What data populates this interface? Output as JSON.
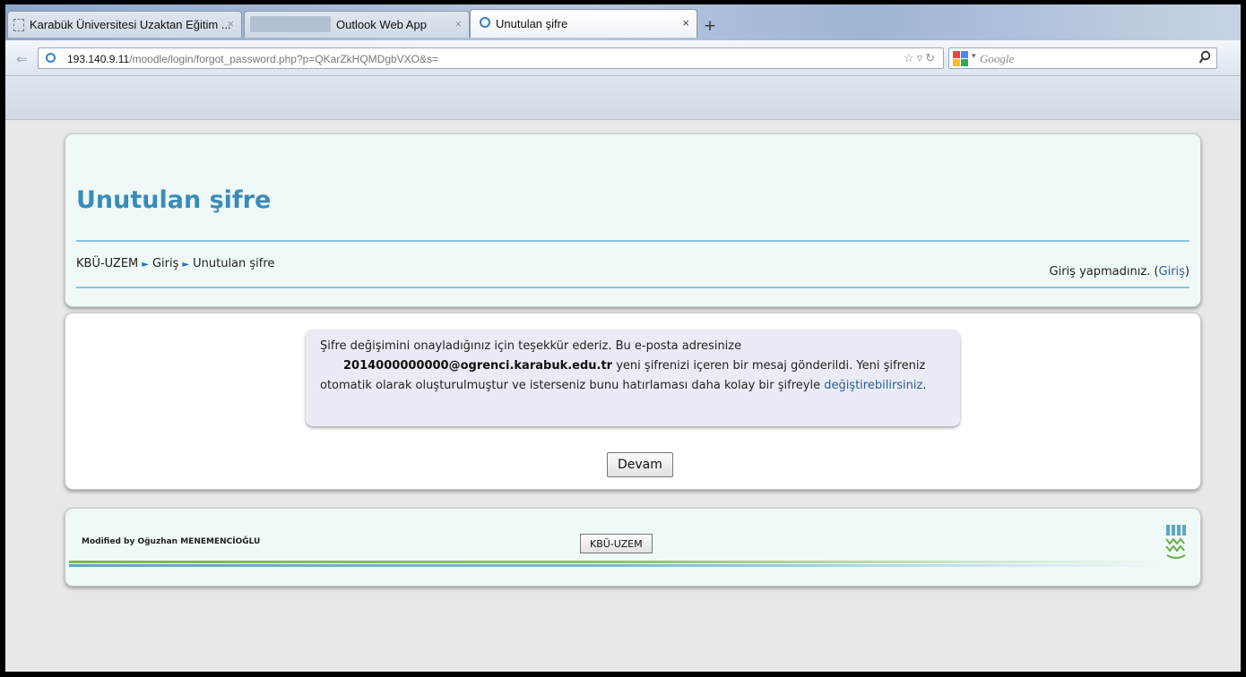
{
  "browser": {
    "tabs": [
      {
        "label": "Karabük Üniversitesi Uzaktan Eğitim ...",
        "close": "×"
      },
      {
        "label": "Outlook Web App",
        "close": "×"
      },
      {
        "label": "Unutulan şifre",
        "close": "×"
      }
    ],
    "new_tab_label": "+",
    "url_host": "193.140.9.11",
    "url_path": "/moodle/login/forgot_password.php?p=QKarZkHQMDgbVXO&s=",
    "search_placeholder": "Google",
    "icons": {
      "back": "back-arrow-icon",
      "site": "site-identity-icon",
      "bookmark": "star-icon",
      "reload": "reload-icon",
      "search_engine": "google-logo-icon",
      "search": "magnifier-icon"
    }
  },
  "header": {
    "title": "Unutulan şifre",
    "breadcrumb": [
      "KBÜ-UZEM",
      "Giriş",
      "Unutulan şifre"
    ],
    "breadcrumb_separator": "►",
    "login_status_prefix": "Giriş yapmadınız. (",
    "login_link": "Giriş",
    "login_status_suffix": ")"
  },
  "notice": {
    "line1": "Şifre değişimini onayladığınız için teşekkür ederiz. Bu e-posta adresinize",
    "email": "2014000000000@ogrenci.karabuk.edu.tr",
    "line2_rest": " yeni şifrenizi içeren bir mesaj gönderildi. Yeni şifreniz",
    "line3_prefix": "otomatik olarak oluşturulmuştur ve isterseniz bunu hatırlaması daha kolay bir şifreyle ",
    "line3_link": "değiştirebilirsiniz",
    "line3_suffix": "."
  },
  "continue_button": "Devam",
  "footer": {
    "credit": "Modified by Oğuzhan MENEMENCİOĞLU",
    "home_button": "KBÜ-UZEM",
    "logo_icon": "kbu-logo-icon"
  },
  "colors": {
    "title": "#3b8bb8",
    "link": "#2a5e9a",
    "header_bg": "#eff9f8",
    "rule": "#88c6db"
  }
}
